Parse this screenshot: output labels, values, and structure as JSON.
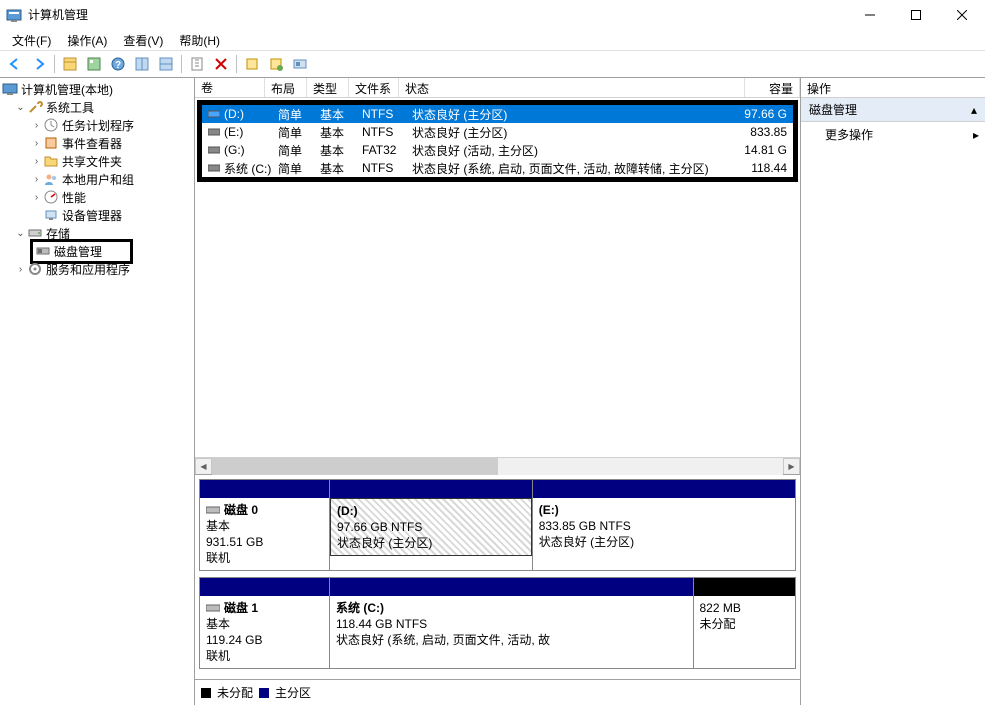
{
  "window": {
    "title": "计算机管理"
  },
  "menu": {
    "file": "文件(F)",
    "action": "操作(A)",
    "view": "查看(V)",
    "help": "帮助(H)"
  },
  "tree": {
    "root": "计算机管理(本地)",
    "system_tools": "系统工具",
    "task_scheduler": "任务计划程序",
    "event_viewer": "事件查看器",
    "shared_folders": "共享文件夹",
    "local_users": "本地用户和组",
    "performance": "性能",
    "device_manager": "设备管理器",
    "storage": "存储",
    "disk_mgmt": "磁盘管理",
    "services_apps": "服务和应用程序"
  },
  "vol_headers": {
    "vol": "卷",
    "layout": "布局",
    "type": "类型",
    "fs": "文件系统",
    "status": "状态",
    "cap": "容量"
  },
  "volumes": [
    {
      "name": "(D:)",
      "layout": "简单",
      "type": "基本",
      "fs": "NTFS",
      "status": "状态良好 (主分区)",
      "cap": "97.66 G",
      "selected": true
    },
    {
      "name": "(E:)",
      "layout": "简单",
      "type": "基本",
      "fs": "NTFS",
      "status": "状态良好 (主分区)",
      "cap": "833.85"
    },
    {
      "name": "(G:)",
      "layout": "简单",
      "type": "基本",
      "fs": "FAT32",
      "status": "状态良好 (活动, 主分区)",
      "cap": "14.81 G"
    },
    {
      "name": "系统 (C:)",
      "layout": "简单",
      "type": "基本",
      "fs": "NTFS",
      "status": "状态良好 (系统, 启动, 页面文件, 活动, 故障转储, 主分区)",
      "cap": "118.44"
    }
  ],
  "disks": [
    {
      "name": "磁盘 0",
      "type": "基本",
      "size": "931.51 GB",
      "status": "联机",
      "parts": [
        {
          "label": "(D:)",
          "size": "97.66 GB NTFS",
          "status": "状态良好 (主分区)",
          "selected": true,
          "flex": 1
        },
        {
          "label": "(E:)",
          "size": "833.85 GB NTFS",
          "status": "状态良好 (主分区)",
          "flex": 1.3
        }
      ]
    },
    {
      "name": "磁盘 1",
      "type": "基本",
      "size": "119.24 GB",
      "status": "联机",
      "parts": [
        {
          "label": "系统  (C:)",
          "size": "118.44 GB NTFS",
          "status": "状态良好 (系统, 启动, 页面文件, 活动, 故",
          "flex": 2.5
        },
        {
          "label": "",
          "size": "822 MB",
          "status": "未分配",
          "unalloc": true,
          "flex": 0.7
        }
      ]
    }
  ],
  "legend": {
    "unalloc": "未分配",
    "primary": "主分区"
  },
  "actions": {
    "header": "操作",
    "section": "磁盘管理",
    "more": "更多操作"
  }
}
